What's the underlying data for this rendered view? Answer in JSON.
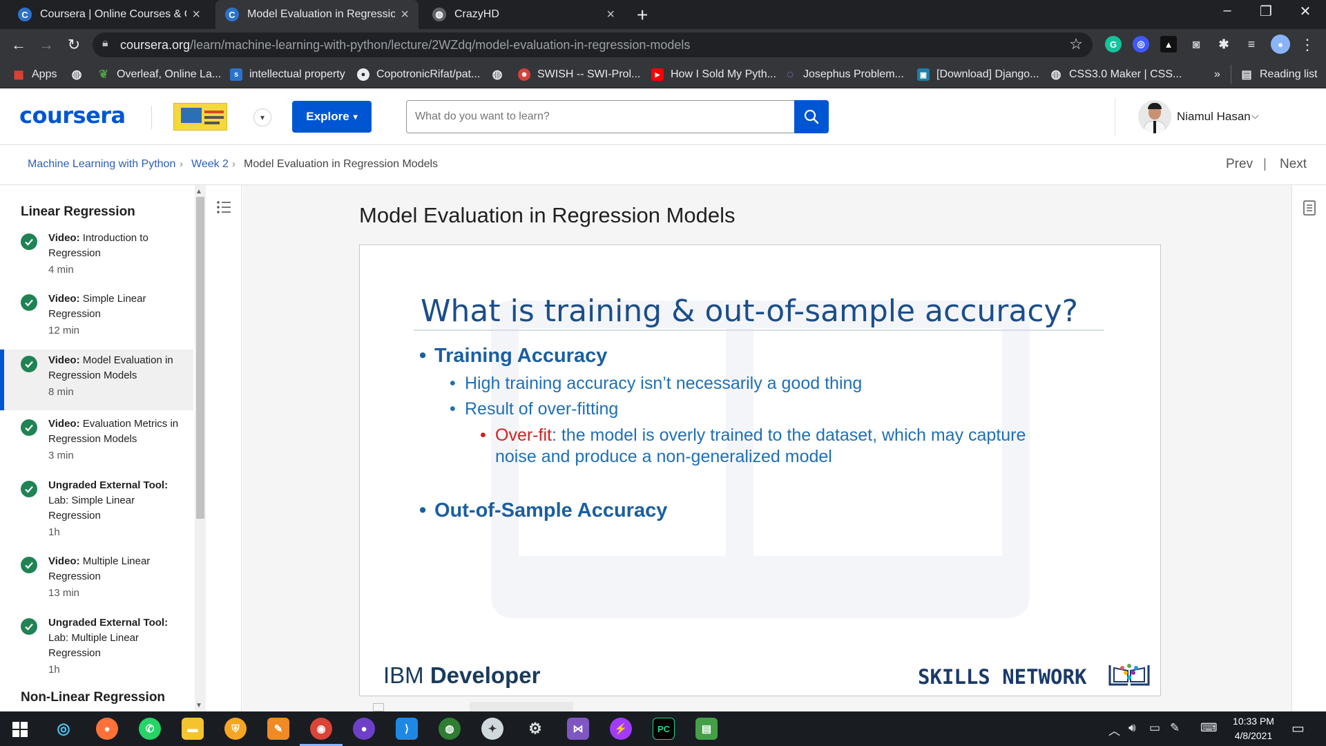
{
  "browser": {
    "tabs": [
      {
        "title": "Coursera | Online Courses & Credentials",
        "favicon": "C"
      },
      {
        "title": "Model Evaluation in Regression Models",
        "favicon": "C"
      },
      {
        "title": "CrazyHD",
        "favicon": ""
      }
    ],
    "new_tab": "+",
    "window_controls": {
      "minimize": "–",
      "maximize": "❐",
      "close": "✕"
    },
    "address": {
      "host": "coursera.org",
      "path": "/learn/machine-learning-with-python/lecture/2WZdq/model-evaluation-in-regression-models"
    },
    "bookmarks": [
      {
        "label": "Apps",
        "icon": "apps-grid-icon",
        "color": "#ea4335"
      },
      {
        "label": "",
        "icon": "globe-icon",
        "color": "#9aa0a6"
      },
      {
        "label": "Overleaf, Online La...",
        "icon": "overleaf-icon",
        "color": "#4f9c45"
      },
      {
        "label": "intellectual property",
        "icon": "doc-icon",
        "color": "#2a73cc"
      },
      {
        "label": "CopotronicRifat/pat...",
        "icon": "github-icon",
        "color": "#e8eaed"
      },
      {
        "label": "",
        "icon": "globe-icon",
        "color": "#9aa0a6"
      },
      {
        "label": "SWISH -- SWI-Prol...",
        "icon": "swish-icon",
        "color": "#d7413a"
      },
      {
        "label": "How I Sold My Pyth...",
        "icon": "youtube-icon",
        "color": "#ff0000"
      },
      {
        "label": "Josephus Problem...",
        "icon": "loading-icon",
        "color": "#6f6fe0"
      },
      {
        "label": "[Download] Django...",
        "icon": "site-icon",
        "color": "#1c7ea8"
      },
      {
        "label": "CSS3.0 Maker | CSS...",
        "icon": "globe-icon",
        "color": "#9aa0a6"
      }
    ],
    "bookmarks_overflow": "»",
    "reading_list": "Reading list"
  },
  "header": {
    "logo": "coursera",
    "explore_label": "Explore",
    "search_placeholder": "What do you want to learn?",
    "user_name": "Niamul Hasan"
  },
  "breadcrumb": {
    "course": "Machine Learning with Python",
    "week": "Week 2",
    "current": "Model Evaluation in Regression Models",
    "prev": "Prev",
    "separator": "|",
    "next": "Next"
  },
  "sidebar": {
    "section1": "Linear Regression",
    "items": [
      {
        "type": "Video:",
        "title": "Introduction to Regression",
        "duration": "4 min"
      },
      {
        "type": "Video:",
        "title": "Simple Linear Regression",
        "duration": "12 min"
      },
      {
        "type": "Video:",
        "title": "Model Evaluation in Regression Models",
        "duration": "8 min"
      },
      {
        "type": "Video:",
        "title": "Evaluation Metrics in Regression Models",
        "duration": "3 min"
      },
      {
        "type": "Ungraded External Tool:",
        "title": "Lab: Simple Linear Regression",
        "duration": "1h"
      },
      {
        "type": "Video:",
        "title": "Multiple Linear Regression",
        "duration": "13 min"
      },
      {
        "type": "Ungraded External Tool:",
        "title": "Lab: Multiple Linear Regression",
        "duration": "1h"
      }
    ],
    "section2": "Non-Linear Regression"
  },
  "main": {
    "title": "Model Evaluation in Regression Models",
    "slide": {
      "heading": "What is training & out-of-sample accuracy?",
      "bullet1": "Training Accuracy",
      "bullet1a": "High training accuracy isn’t necessarily a good thing",
      "bullet1b": "Result of over-fitting",
      "bullet1c_term": "Over-fit",
      "bullet1c_line1": ": the model is overly trained to the dataset, which may capture",
      "bullet1c_line2": "noise and produce a non-generalized model",
      "bullet2": "Out-of-Sample Accuracy",
      "footer_left_1": "IBM",
      "footer_left_2": "Developer",
      "footer_right": "SKILLS NETWORK"
    }
  },
  "taskbar": {
    "time": "10:33 PM",
    "date": "4/8/2021"
  }
}
